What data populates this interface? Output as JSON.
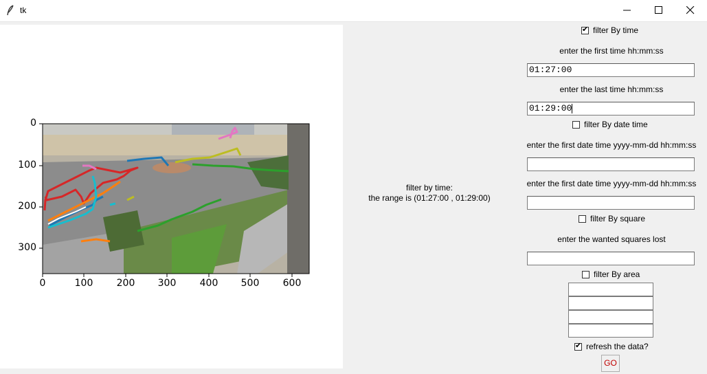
{
  "window": {
    "title": "tk",
    "icons": [
      "feather-icon",
      "minimize-icon",
      "maximize-icon",
      "close-icon"
    ]
  },
  "plot": {
    "y_ticks": [
      "0",
      "100",
      "200",
      "300"
    ],
    "x_ticks": [
      "0",
      "100",
      "200",
      "300",
      "400",
      "500",
      "600"
    ],
    "track_colors": [
      "#d62728",
      "#ff7f0e",
      "#1f77b4",
      "#17becf",
      "#2ca02c",
      "#bcbd22",
      "#e377c2"
    ]
  },
  "info": {
    "line1": "filter by time:",
    "line2": "the range is (01:27:00 , 01:29:00)"
  },
  "filters": {
    "by_time": {
      "label": "filter By time",
      "checked": true
    },
    "first_time_label": "enter the first time hh:mm:ss",
    "first_time_value": "01:27:00",
    "last_time_label": "enter the last time hh:mm:ss",
    "last_time_value": "01:29:00",
    "by_date_time": {
      "label": "filter By date time",
      "checked": false
    },
    "first_datetime_label": "enter the first date time yyyy-mm-dd hh:mm:ss",
    "second_datetime_label": "enter the first date time yyyy-mm-dd hh:mm:ss",
    "by_square": {
      "label": "filter By square",
      "checked": false
    },
    "squares_label": "enter the wanted squares lost",
    "by_area": {
      "label": "filter By area",
      "checked": false
    },
    "refresh": {
      "label": "refresh the data?",
      "checked": true
    },
    "go_label": "GO"
  }
}
